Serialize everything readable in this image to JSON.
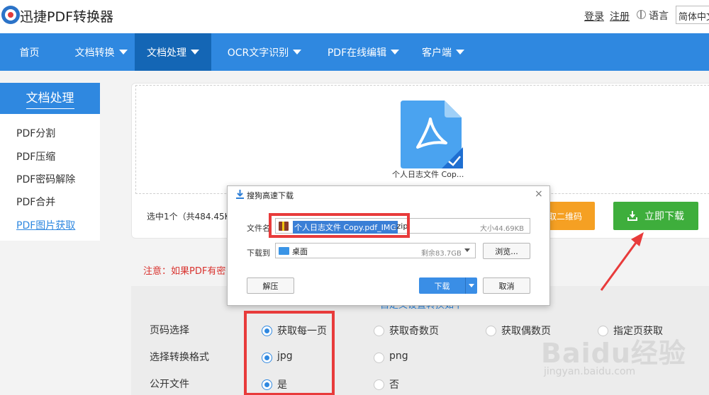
{
  "header": {
    "app_title": "迅捷PDF转换器",
    "login": "登录",
    "register": "注册",
    "language_label": "语言",
    "language_value": "简体中文"
  },
  "nav": {
    "items": [
      {
        "label": "首页",
        "has_caret": false,
        "active": false
      },
      {
        "label": "文档转换",
        "has_caret": true,
        "active": false
      },
      {
        "label": "文档处理",
        "has_caret": true,
        "active": true
      },
      {
        "label": "OCR文字识别",
        "has_caret": true,
        "active": false
      },
      {
        "label": "PDF在线编辑",
        "has_caret": true,
        "active": false
      },
      {
        "label": "客户端",
        "has_caret": true,
        "active": false
      }
    ]
  },
  "sidebar": {
    "title": "文档处理",
    "items": [
      {
        "label": "PDF分割"
      },
      {
        "label": "PDF压缩"
      },
      {
        "label": "PDF密码解除"
      },
      {
        "label": "PDF合并"
      },
      {
        "label": "PDF图片获取"
      }
    ]
  },
  "upload": {
    "file_name": "个人日志文件 Cop...",
    "selected_info": "选中1个（共484.45K",
    "qr_button": "取二维码",
    "download_button": "立即下载"
  },
  "notice": "注意：如果PDF有密",
  "options": {
    "title": "自定义设置转换如下",
    "rows": [
      {
        "label": "页码选择",
        "choices": [
          "获取每一页",
          "获取奇数页",
          "获取偶数页",
          "指定页获取"
        ],
        "selected": 0
      },
      {
        "label": "选择转换格式",
        "choices": [
          "jpg",
          "png"
        ],
        "selected": 0
      },
      {
        "label": "公开文件",
        "choices": [
          "是",
          "否"
        ],
        "selected": 0
      }
    ]
  },
  "dialog": {
    "title": "搜狗高速下载",
    "close": "×",
    "filename_label": "文件名",
    "filename_selected": "个人日志文件 Copy.pdf_IMG",
    "filename_ext": ".zip",
    "size_text": "大小44.69KB",
    "dest_label": "下载到",
    "dest_value": "桌面",
    "free_space": "剩余83.7GB",
    "browse_button": "浏览...",
    "unzip_button": "解压",
    "download_button": "下载",
    "cancel_button": "取消"
  },
  "watermark": {
    "brand": "Baidu经验",
    "url": "jingyan.baidu.com"
  },
  "colors": {
    "nav_bg": "#2f88e0",
    "nav_active": "#1466b5",
    "green_button": "#3eae3c",
    "orange_button": "#f5a023",
    "highlight_red": "#e83b3b",
    "notice_red": "#d9332f"
  }
}
